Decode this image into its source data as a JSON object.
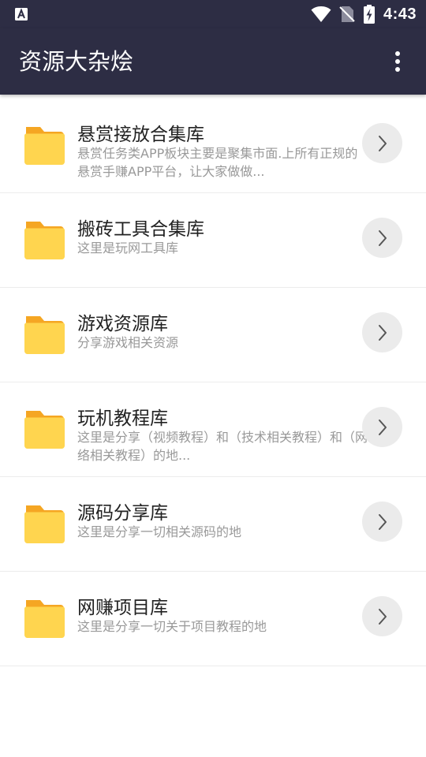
{
  "status_bar": {
    "left_icon": "a-notification-icon",
    "icons": [
      "wifi-icon",
      "no-sim-icon",
      "battery-charging-icon"
    ],
    "time": "4:43"
  },
  "app_bar": {
    "title": "资源大杂烩",
    "menu_icon": "more-vert-icon"
  },
  "colors": {
    "app_bar": "#2d2d44",
    "folder_main": "#ffd54f",
    "folder_tab": "#f5a623",
    "chevron_bg": "#ebebeb",
    "title_text": "#222222",
    "desc_text": "#999999"
  },
  "list": {
    "items": [
      {
        "title": "悬赏接放合集库",
        "desc": "悬赏任务类APP板块主要是聚集市面.上所有正规的悬赏手赚APP平台，让大家做做..."
      },
      {
        "title": "搬砖工具合集库",
        "desc": "这里是玩网工具库"
      },
      {
        "title": "游戏资源库",
        "desc": "分享游戏相关资源"
      },
      {
        "title": "玩机教程库",
        "desc": "这里是分享（视频教程）和（技术相关教程）和（网络相关教程）的地..."
      },
      {
        "title": "源码分享库",
        "desc": "这里是分享一切相关源码的地"
      },
      {
        "title": "网赚项目库",
        "desc": "这里是分享一切关于项目教程的地"
      }
    ]
  }
}
